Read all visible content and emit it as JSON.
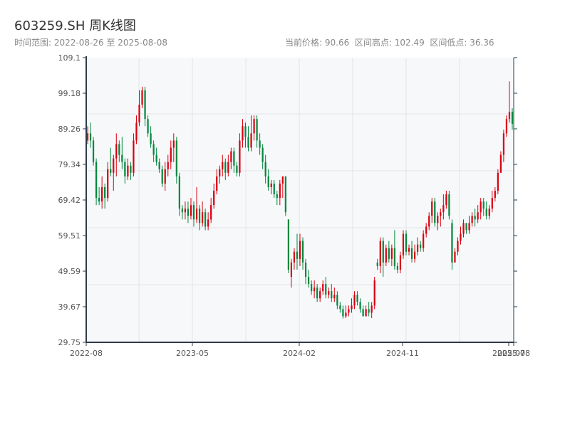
{
  "header": {
    "title": "603259.SH 周K线图",
    "range_label": "时间范围: 2022-08-26 至 2025-08-08",
    "current_price": "当前价格: 90.66",
    "period_high": "区间高点: 102.49",
    "period_low": "区间低点: 36.36"
  },
  "chart_data": {
    "type": "candlestick",
    "title": "603259.SH 周K线图",
    "date_range": [
      "2022-08-26",
      "2025-08-08"
    ],
    "ylim": [
      29.75,
      109.1
    ],
    "y_ticks": [
      "109.1",
      "99.18",
      "89.26",
      "79.34",
      "69.42",
      "59.51",
      "49.59",
      "39.67",
      "29.75"
    ],
    "x_ticks": [
      "2022-08",
      "2023-05",
      "2024-02",
      "2024-11",
      "2025-07",
      "2025-08"
    ],
    "grid": true,
    "colors": {
      "up": "#d9000f",
      "down": "#00873c"
    },
    "ohlc_fields": [
      "open",
      "close",
      "low",
      "high"
    ],
    "candles": [
      [
        86,
        88,
        85,
        90
      ],
      [
        88,
        86,
        84,
        91
      ],
      [
        86,
        80,
        79,
        87
      ],
      [
        80,
        70,
        68,
        81
      ],
      [
        70,
        69,
        68,
        73
      ],
      [
        69,
        73,
        67,
        76
      ],
      [
        73,
        70,
        67,
        74
      ],
      [
        70,
        78,
        69,
        80
      ],
      [
        78,
        77,
        76,
        84
      ],
      [
        77,
        81,
        72,
        82
      ],
      [
        81,
        85,
        76,
        88
      ],
      [
        85,
        82,
        80,
        86
      ],
      [
        82,
        80,
        78,
        87
      ],
      [
        80,
        76,
        74,
        81
      ],
      [
        76,
        79,
        75,
        81
      ],
      [
        79,
        77,
        75,
        80
      ],
      [
        77,
        86,
        76,
        88
      ],
      [
        86,
        91,
        85,
        93
      ],
      [
        91,
        96,
        90,
        100
      ],
      [
        96,
        100,
        95,
        101
      ],
      [
        100,
        92,
        90,
        101
      ],
      [
        92,
        88,
        87,
        93
      ],
      [
        88,
        85,
        84,
        90
      ],
      [
        85,
        82,
        80,
        86
      ],
      [
        82,
        80,
        79,
        84
      ],
      [
        80,
        78,
        77,
        81
      ],
      [
        78,
        74,
        73,
        79
      ],
      [
        74,
        78,
        72,
        80
      ],
      [
        78,
        80,
        76,
        82
      ],
      [
        80,
        84,
        78,
        86
      ],
      [
        84,
        86,
        80,
        88
      ],
      [
        86,
        76,
        74,
        87
      ],
      [
        76,
        67,
        65,
        77
      ],
      [
        67,
        66,
        64,
        68
      ],
      [
        66,
        67,
        64,
        69
      ],
      [
        67,
        65,
        63,
        69
      ],
      [
        65,
        68,
        64,
        70
      ],
      [
        68,
        64,
        62,
        69
      ],
      [
        64,
        67,
        63,
        73
      ],
      [
        67,
        63,
        61,
        68
      ],
      [
        63,
        66,
        62,
        69
      ],
      [
        66,
        62,
        61,
        67
      ],
      [
        62,
        64,
        61,
        66
      ],
      [
        64,
        68,
        63,
        70
      ],
      [
        68,
        72,
        67,
        74
      ],
      [
        72,
        76,
        71,
        78
      ],
      [
        76,
        78,
        74,
        79
      ],
      [
        78,
        80,
        76,
        82
      ],
      [
        80,
        77,
        75,
        81
      ],
      [
        77,
        80,
        76,
        82
      ],
      [
        80,
        83,
        78,
        84
      ],
      [
        83,
        79,
        77,
        84
      ],
      [
        79,
        77,
        76,
        80
      ],
      [
        77,
        86,
        76,
        88
      ],
      [
        86,
        90,
        84,
        92
      ],
      [
        90,
        87,
        84,
        91
      ],
      [
        87,
        84,
        83,
        90
      ],
      [
        84,
        88,
        83,
        93
      ],
      [
        88,
        92,
        86,
        93
      ],
      [
        92,
        86,
        84,
        93
      ],
      [
        86,
        84,
        82,
        88
      ],
      [
        84,
        80,
        78,
        85
      ],
      [
        80,
        76,
        74,
        82
      ],
      [
        76,
        73,
        72,
        78
      ],
      [
        73,
        74,
        71,
        75
      ],
      [
        74,
        71,
        70,
        75
      ],
      [
        71,
        70,
        68,
        72
      ],
      [
        70,
        74,
        68,
        75
      ],
      [
        74,
        76,
        70,
        76
      ],
      [
        76,
        66,
        65,
        76
      ],
      [
        64,
        50,
        49,
        64
      ],
      [
        48,
        52,
        45,
        53
      ],
      [
        52,
        55,
        50,
        56
      ],
      [
        55,
        53,
        50,
        60
      ],
      [
        53,
        58,
        51,
        60
      ],
      [
        58,
        52,
        50,
        59
      ],
      [
        52,
        48,
        46,
        53
      ],
      [
        48,
        46,
        45,
        50
      ],
      [
        46,
        44,
        43,
        47
      ],
      [
        44,
        45,
        42,
        47
      ],
      [
        45,
        42,
        41,
        46
      ],
      [
        42,
        44,
        41,
        45
      ],
      [
        44,
        46,
        43,
        47
      ],
      [
        46,
        43,
        42,
        48
      ],
      [
        43,
        44,
        42,
        45
      ],
      [
        44,
        42,
        41,
        46
      ],
      [
        42,
        43,
        41,
        45
      ],
      [
        43,
        40,
        39,
        44
      ],
      [
        40,
        39,
        38,
        41
      ],
      [
        39,
        37,
        36.36,
        40
      ],
      [
        37,
        38,
        36.5,
        40
      ],
      [
        38,
        39,
        37,
        40
      ],
      [
        39,
        40,
        38,
        42
      ],
      [
        40,
        43,
        39,
        44
      ],
      [
        43,
        41,
        40,
        44
      ],
      [
        41,
        39,
        38,
        42
      ],
      [
        39,
        37,
        37,
        40
      ],
      [
        37,
        39,
        37,
        40
      ],
      [
        39,
        38,
        37,
        41
      ],
      [
        38,
        40,
        36.5,
        41
      ],
      [
        40,
        47,
        39,
        48
      ],
      [
        52,
        51,
        50,
        53
      ],
      [
        51,
        58,
        49,
        59
      ],
      [
        58,
        52,
        48,
        59
      ],
      [
        52,
        56,
        51,
        57
      ],
      [
        56,
        53,
        52,
        58
      ],
      [
        53,
        56,
        51,
        57
      ],
      [
        56,
        51,
        50,
        61
      ],
      [
        51,
        50,
        49,
        52
      ],
      [
        50,
        54,
        49,
        55
      ],
      [
        54,
        60,
        53,
        61
      ],
      [
        60,
        55,
        54,
        61
      ],
      [
        55,
        56,
        54,
        57
      ],
      [
        56,
        53,
        52,
        58
      ],
      [
        53,
        55,
        52,
        57
      ],
      [
        55,
        57,
        54,
        59
      ],
      [
        57,
        56,
        55,
        58
      ],
      [
        56,
        60,
        55,
        61
      ],
      [
        60,
        62,
        59,
        63
      ],
      [
        62,
        65,
        61,
        66
      ],
      [
        65,
        69,
        63,
        70
      ],
      [
        69,
        63,
        62,
        70
      ],
      [
        63,
        65,
        61,
        66
      ],
      [
        65,
        66,
        62,
        67
      ],
      [
        66,
        68,
        64,
        71
      ],
      [
        68,
        71,
        67,
        72
      ],
      [
        71,
        65,
        64,
        72
      ],
      [
        63,
        52,
        50,
        64
      ],
      [
        52,
        55,
        52,
        56
      ],
      [
        55,
        58,
        54,
        59
      ],
      [
        58,
        60,
        57,
        62
      ],
      [
        60,
        63,
        59,
        64
      ],
      [
        63,
        61,
        60,
        63
      ],
      [
        61,
        63,
        60,
        65
      ],
      [
        63,
        65,
        62,
        66
      ],
      [
        65,
        64,
        62,
        67
      ],
      [
        64,
        66,
        63,
        68
      ],
      [
        66,
        69,
        64,
        70
      ],
      [
        69,
        67,
        65,
        70
      ],
      [
        67,
        65,
        64,
        69
      ],
      [
        65,
        67,
        64,
        68
      ],
      [
        67,
        70,
        66,
        72
      ],
      [
        70,
        72,
        69,
        73
      ],
      [
        72,
        77,
        71,
        78
      ],
      [
        77,
        82,
        77,
        83
      ],
      [
        82,
        88,
        80,
        89
      ],
      [
        88,
        92,
        87,
        93
      ],
      [
        92,
        94,
        91,
        102.49
      ],
      [
        94,
        90.66,
        89,
        95
      ]
    ]
  }
}
